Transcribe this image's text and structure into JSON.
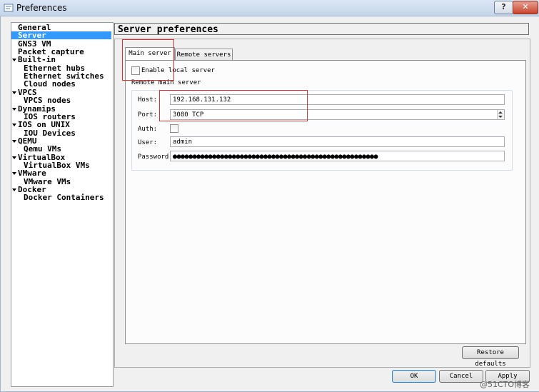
{
  "window": {
    "title": "Preferences",
    "help_label": "?",
    "close_label": "✕"
  },
  "sidebar": {
    "items": [
      {
        "label": "General",
        "indent": 0,
        "expandable": false,
        "selected": false
      },
      {
        "label": "Server",
        "indent": 0,
        "expandable": false,
        "selected": true
      },
      {
        "label": "GNS3 VM",
        "indent": 0,
        "expandable": false,
        "selected": false
      },
      {
        "label": "Packet capture",
        "indent": 0,
        "expandable": false,
        "selected": false
      },
      {
        "label": "Built-in",
        "indent": 0,
        "expandable": true,
        "selected": false
      },
      {
        "label": "Ethernet hubs",
        "indent": 1,
        "expandable": false,
        "selected": false
      },
      {
        "label": "Ethernet switches",
        "indent": 1,
        "expandable": false,
        "selected": false
      },
      {
        "label": "Cloud nodes",
        "indent": 1,
        "expandable": false,
        "selected": false
      },
      {
        "label": "VPCS",
        "indent": 0,
        "expandable": true,
        "selected": false
      },
      {
        "label": "VPCS nodes",
        "indent": 1,
        "expandable": false,
        "selected": false
      },
      {
        "label": "Dynamips",
        "indent": 0,
        "expandable": true,
        "selected": false
      },
      {
        "label": "IOS routers",
        "indent": 1,
        "expandable": false,
        "selected": false
      },
      {
        "label": "IOS on UNIX",
        "indent": 0,
        "expandable": true,
        "selected": false
      },
      {
        "label": "IOU Devices",
        "indent": 1,
        "expandable": false,
        "selected": false
      },
      {
        "label": "QEMU",
        "indent": 0,
        "expandable": true,
        "selected": false
      },
      {
        "label": "Qemu VMs",
        "indent": 1,
        "expandable": false,
        "selected": false
      },
      {
        "label": "VirtualBox",
        "indent": 0,
        "expandable": true,
        "selected": false
      },
      {
        "label": "VirtualBox VMs",
        "indent": 1,
        "expandable": false,
        "selected": false
      },
      {
        "label": "VMware",
        "indent": 0,
        "expandable": true,
        "selected": false
      },
      {
        "label": "VMware VMs",
        "indent": 1,
        "expandable": false,
        "selected": false
      },
      {
        "label": "Docker",
        "indent": 0,
        "expandable": true,
        "selected": false
      },
      {
        "label": "Docker Containers",
        "indent": 1,
        "expandable": false,
        "selected": false
      }
    ]
  },
  "main": {
    "header": "Server preferences",
    "tabs": [
      {
        "label": "Main server",
        "active": true
      },
      {
        "label": "Remote servers",
        "active": false
      }
    ],
    "enable_local_label": "Enable local server",
    "enable_local_checked": false,
    "group_title": "Remote main server",
    "host_label": "Host:",
    "host_value": "192.168.131.132",
    "port_label": "Port:",
    "port_value": "3080 TCP",
    "auth_label": "Auth:",
    "auth_checked": false,
    "user_label": "User:",
    "user_value": "admin",
    "password_label": "Password:",
    "password_mask": "●●●●●●●●●●●●●●●●●●●●●●●●●●●●●●●●●●●●●●●●●●●●●●●●●●●●",
    "restore_defaults_label": "Restore defaults"
  },
  "footer": {
    "ok_label": "OK",
    "cancel_label": "Cancel",
    "apply_label": "Apply"
  },
  "watermark": "@51CTO博客",
  "colors": {
    "selection": "#3399ff",
    "highlight_box": "#e03030"
  }
}
